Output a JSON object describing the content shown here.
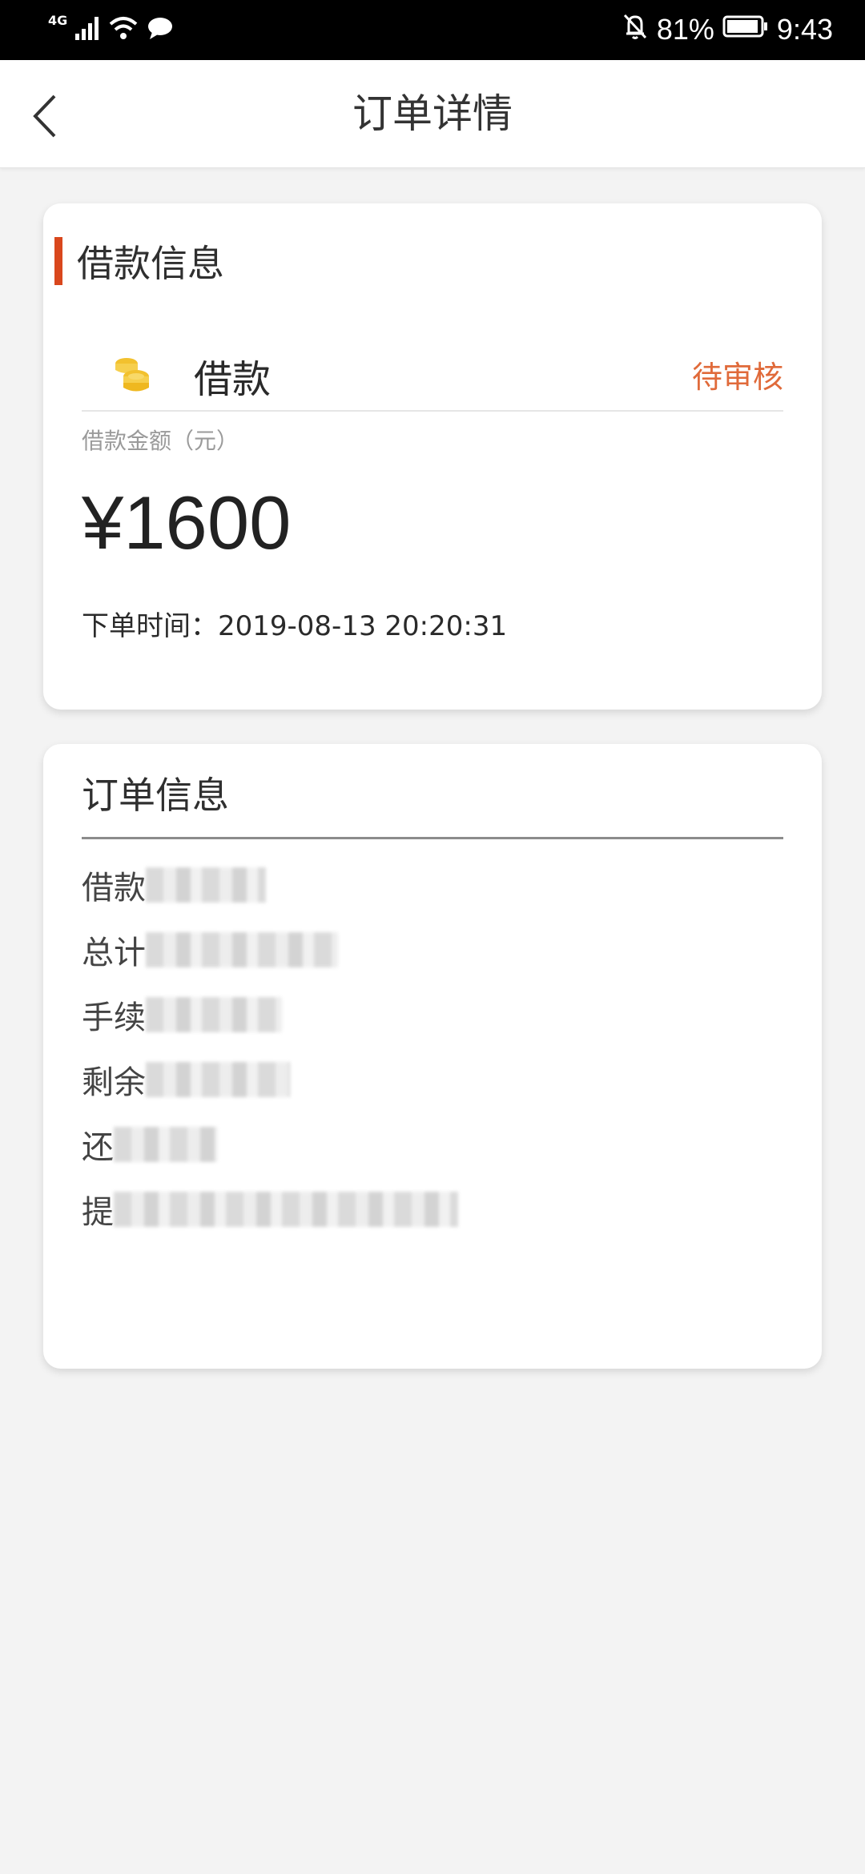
{
  "status_bar": {
    "network": "4G",
    "battery": "81%",
    "time": "9:43"
  },
  "header": {
    "title": "订单详情"
  },
  "loan_card": {
    "section_title": "借款信息",
    "loan_name": "借款",
    "status": "待审核",
    "amount_label": "借款金额（元）",
    "amount": "¥1600",
    "order_time": "下单时间：2019-08-13 20:20:31"
  },
  "order_info": {
    "title": "订单信息",
    "items": [
      {
        "label": "借款"
      },
      {
        "label": "总计"
      },
      {
        "label": "手续"
      },
      {
        "label": "剩余"
      },
      {
        "label": "还"
      },
      {
        "label": "提"
      }
    ]
  },
  "colors": {
    "accent": "#d9471d",
    "status_orange": "#e06a3a",
    "coin_yellow": "#f2c12e"
  },
  "icons": [
    "back-chevron-icon",
    "signal-icon",
    "wifi-icon",
    "message-icon",
    "mute-bell-icon",
    "battery-icon",
    "coins-icon"
  ]
}
